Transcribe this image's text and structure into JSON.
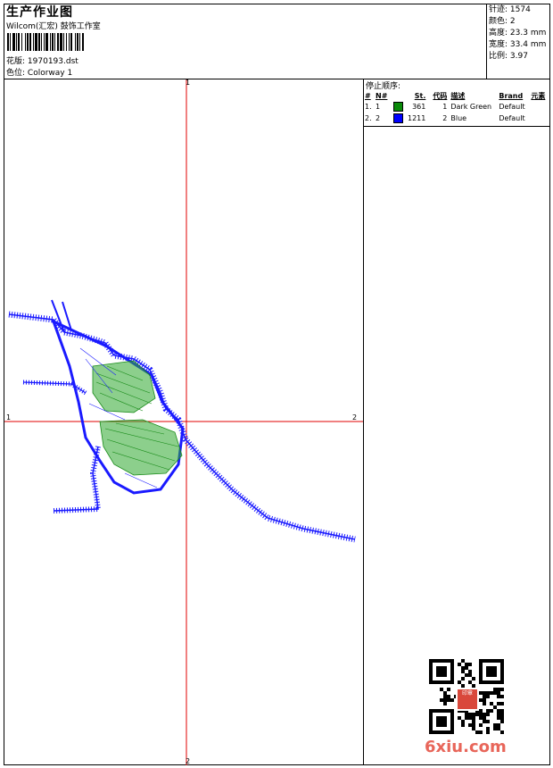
{
  "header": {
    "title": "生产作业图",
    "studio": "Wilcom(汇宏) 鼓饰工作室",
    "design_label": "花版:",
    "design_value": "1970193.dst",
    "colorway_label": "色位:",
    "colorway_value": "Colorway 1"
  },
  "stats": [
    {
      "label": "针迹:",
      "value": "1574"
    },
    {
      "label": "颜色:",
      "value": "2"
    },
    {
      "label": "高度:",
      "value": "23.3 mm"
    },
    {
      "label": "宽度:",
      "value": "33.4 mm"
    },
    {
      "label": "比例:",
      "value": "3.97"
    }
  ],
  "stop_sequence": {
    "title": "停止顺序:",
    "headers": {
      "num": "#",
      "n": "N#",
      "st": "St.",
      "code": "代码",
      "desc": "描述",
      "brand": "Brand",
      "elem": "元素"
    },
    "rows": [
      {
        "num": "1.",
        "n": "1",
        "color": "#0a8a0a",
        "st": "361",
        "code": "1",
        "desc": "Dark Green",
        "brand": "Default"
      },
      {
        "num": "2.",
        "n": "2",
        "color": "#0000ff",
        "st": "1211",
        "code": "2",
        "desc": "Blue",
        "brand": "Default"
      }
    ]
  },
  "axes": {
    "top": "1",
    "bottom": "2",
    "left": "1",
    "right": "2"
  },
  "watermark": "6xiu.com",
  "seal_text": "印章"
}
